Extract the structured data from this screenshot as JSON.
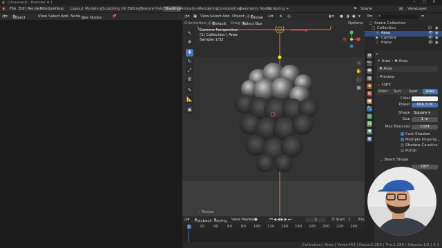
{
  "titlebar": {
    "title": "(Unsaved) - Blender 4.1"
  },
  "menu": {
    "items": [
      "File",
      "Edit",
      "Render",
      "Window",
      "Help"
    ],
    "workspaces": [
      "Layout",
      "Modeling",
      "Sculpting",
      "UV Editing",
      "Texture Paint",
      "Shading",
      "Animation",
      "Rendering",
      "Compositing",
      "Geometry Nodes",
      "Scripting"
    ],
    "active_workspace": "Shading",
    "scene_label": "Scene",
    "viewlayer_label": "ViewLayer"
  },
  "left_editor": {
    "mode": "Object",
    "menus": [
      "View",
      "Select",
      "Add",
      "Node"
    ],
    "use_nodes": "Use Nodes"
  },
  "viewport": {
    "orientation_label": "Orientation:",
    "orientation_value": "Default",
    "drag_label": "Drag:",
    "drag_value": "Select Box",
    "transform": "Global",
    "menus": [
      "View",
      "Select",
      "Add",
      "Object"
    ],
    "options": "Options",
    "overlay_line1": "Camera Perspective",
    "overlay_line2": "(1) Collection | Area",
    "overlay_line3": "Sample 1/32"
  },
  "timeline": {
    "menus": [
      "Playback",
      "Keying",
      "View",
      "Marker"
    ],
    "current_frame": "1",
    "start_label": "Start",
    "start_value": "1",
    "end_label": "End",
    "ticks": [
      "1",
      "20",
      "40",
      "60",
      "80",
      "100",
      "120",
      "140",
      "160",
      "180",
      "200",
      "220",
      "240"
    ],
    "resize_label": "Resize"
  },
  "statusbar": {
    "text": "Collection | Area | Verts:442 | Faces:1,280 | Tris:1,280 | Objects:1/3 | 4.1"
  },
  "outliner": {
    "search_placeholder": "",
    "rows": [
      {
        "label": "Scene Collection",
        "indent": 0
      },
      {
        "label": "Collection",
        "indent": 1
      },
      {
        "label": "Area",
        "indent": 2
      },
      {
        "label": "Camera",
        "indent": 2
      },
      {
        "label": "Plane",
        "indent": 2
      }
    ]
  },
  "properties": {
    "object_name": "Area",
    "data_name": "Area",
    "data_field": "Area",
    "preview_label": "Preview",
    "light_label": "Light",
    "light_types": [
      "Point",
      "Sun",
      "Spot",
      "Area"
    ],
    "active_light_type": "Area",
    "color_label": "Color",
    "power_label": "Power",
    "power_value": "666.3 W",
    "shape_label": "Shape",
    "shape_value": "Square",
    "size_label": "Size",
    "size_value": "1 m",
    "max_bounces_label": "Max Bounces",
    "max_bounces_value": "1024",
    "checkboxes": [
      {
        "label": "Cast Shadow",
        "checked": true
      },
      {
        "label": "Multiple Importa...",
        "checked": true
      },
      {
        "label": "Shadow Caustics",
        "checked": false
      },
      {
        "label": "Portal",
        "checked": false
      }
    ],
    "beam_shape_label": "Beam Shape",
    "spread_value": "180°"
  },
  "colors": {
    "accent": "#4772b3",
    "active_object": "#f5a623",
    "viewport_bg": "#3c3c3c"
  }
}
